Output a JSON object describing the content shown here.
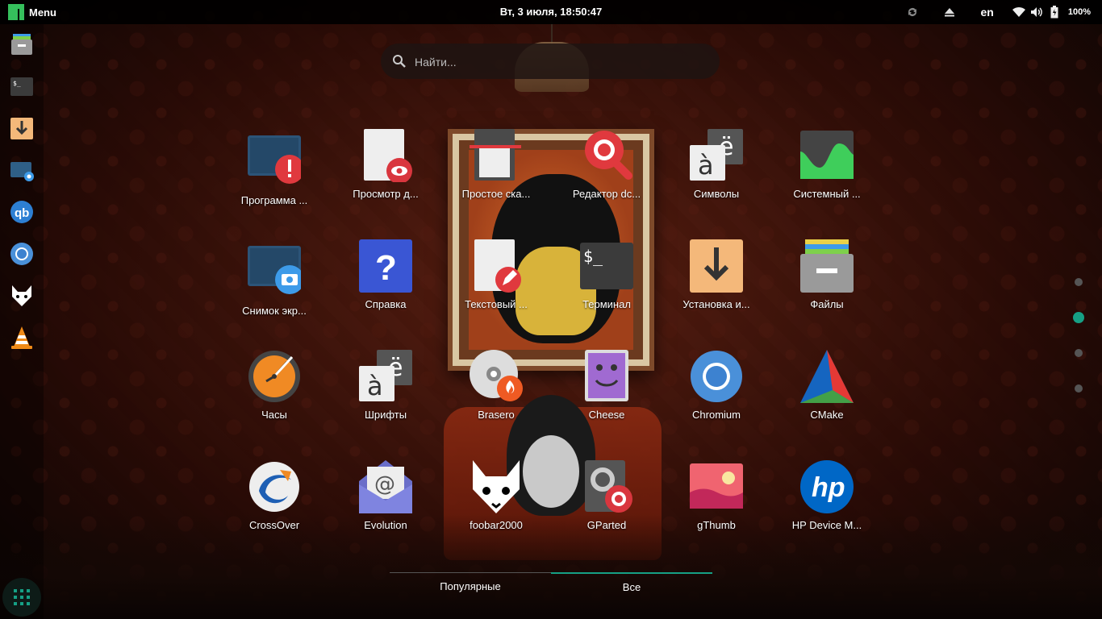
{
  "top_panel": {
    "menu_label": "Menu",
    "clock": "Вт, 3 июля, 18:50:47",
    "keyboard_layout": "en",
    "battery": "100%"
  },
  "search": {
    "placeholder": "Найти..."
  },
  "dock": {
    "items": [
      {
        "name": "files",
        "icon": "file-cabinet-icon"
      },
      {
        "name": "terminal",
        "icon": "terminal-icon"
      },
      {
        "name": "installer",
        "icon": "download-arrow-icon"
      },
      {
        "name": "screenshot",
        "icon": "camera-screen-icon"
      },
      {
        "name": "qbittorrent",
        "icon": "qb-icon"
      },
      {
        "name": "chromium",
        "icon": "chromium-icon"
      },
      {
        "name": "foobar2000",
        "icon": "fox-icon"
      },
      {
        "name": "vlc",
        "icon": "traffic-cone-icon"
      }
    ]
  },
  "apps": [
    {
      "label": "Программа ...",
      "icon": "monitor-error-icon"
    },
    {
      "label": "Просмотр д...",
      "icon": "document-viewer-icon"
    },
    {
      "label": "Простое ска...",
      "icon": "scanner-icon"
    },
    {
      "label": "Редактор dc...",
      "icon": "dconf-search-icon"
    },
    {
      "label": "Символы",
      "icon": "characters-icon"
    },
    {
      "label": "Системный ...",
      "icon": "system-monitor-icon"
    },
    {
      "label": "Снимок экр...",
      "icon": "screenshot-icon"
    },
    {
      "label": "Справка",
      "icon": "help-icon"
    },
    {
      "label": "Текстовый ...",
      "icon": "text-editor-icon"
    },
    {
      "label": "Терминал",
      "icon": "terminal-icon"
    },
    {
      "label": "Установка и...",
      "icon": "install-icon"
    },
    {
      "label": "Файлы",
      "icon": "files-icon"
    },
    {
      "label": "Часы",
      "icon": "clock-icon"
    },
    {
      "label": "Шрифты",
      "icon": "fonts-icon"
    },
    {
      "label": "Brasero",
      "icon": "disc-burner-icon"
    },
    {
      "label": "Cheese",
      "icon": "cheese-icon"
    },
    {
      "label": "Chromium",
      "icon": "chromium-icon"
    },
    {
      "label": "CMake",
      "icon": "cmake-icon"
    },
    {
      "label": "CrossOver",
      "icon": "crossover-icon"
    },
    {
      "label": "Evolution",
      "icon": "mail-icon"
    },
    {
      "label": "foobar2000",
      "icon": "fox-icon"
    },
    {
      "label": "GParted",
      "icon": "gparted-icon"
    },
    {
      "label": "gThumb",
      "icon": "image-viewer-icon"
    },
    {
      "label": "HP Device M...",
      "icon": "hp-icon"
    }
  ],
  "pages": {
    "count": 4,
    "active": 2
  },
  "tabs": [
    {
      "label": "Популярные",
      "active": false
    },
    {
      "label": "Все",
      "active": true
    }
  ],
  "colors": {
    "accent": "#16a085",
    "manjaro_green": "#35bf5c"
  }
}
